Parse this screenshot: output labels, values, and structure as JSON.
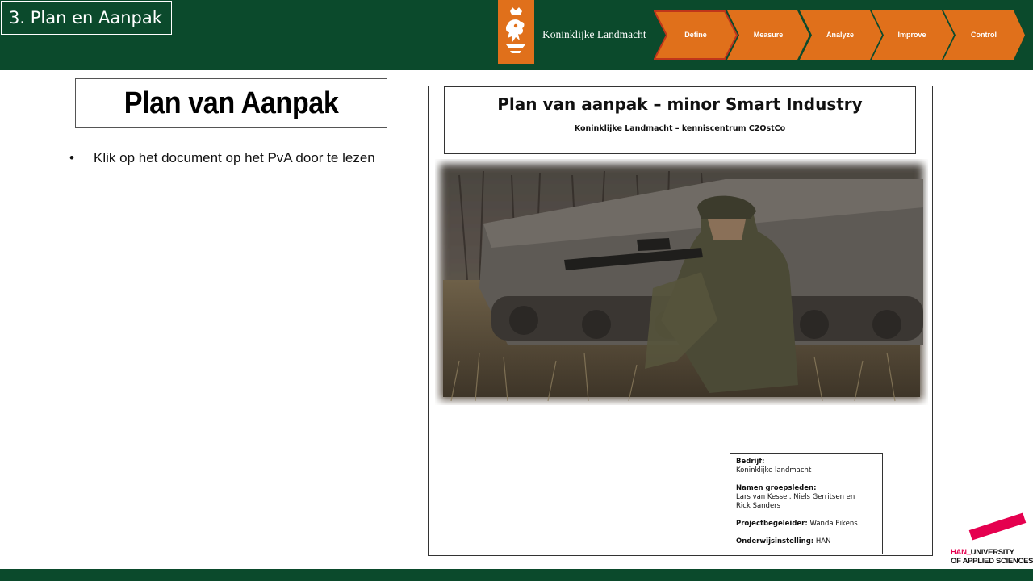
{
  "header": {
    "slide_tag": "3. Plan en Aanpak",
    "organisation": "Koninklijke Landmacht",
    "logo_icon": "lion-crest-icon",
    "brand_color": "#0b4a2c",
    "accent_color": "#e0701b",
    "steps": [
      {
        "label": "Define",
        "active": true
      },
      {
        "label": "Measure",
        "active": false
      },
      {
        "label": "Analyze",
        "active": false
      },
      {
        "label": "Improve",
        "active": false
      },
      {
        "label": "Control",
        "active": false
      }
    ]
  },
  "main": {
    "title": "Plan van Aanpak",
    "bullets": [
      "Klik op het document op het PvA door te lezen"
    ]
  },
  "document": {
    "title": "Plan van aanpak – minor Smart Industry",
    "subtitle": "Koninklijke Landmacht – kenniscentrum C2OstCo",
    "photo": "soldier-kneeling-beside-armored-vehicle",
    "info": {
      "company_label": "Bedrijf:",
      "company": "Koninklijke landmacht",
      "members_label": "Namen groepsleden:",
      "members_line1": "Lars van Kessel, Niels Gerritsen en",
      "members_line2": "Rick Sanders",
      "supervisor_label": "Projectbegeleider:",
      "supervisor": "Wanda Eikens",
      "institution_label": "Onderwijsinstelling:",
      "institution": "HAN"
    }
  },
  "footer": {
    "logo_prefix": "HAN_",
    "logo_line1_rest": "UNIVERSITY",
    "logo_line2": "OF APPLIED SCIENCES",
    "logo_color": "#e5004f"
  }
}
